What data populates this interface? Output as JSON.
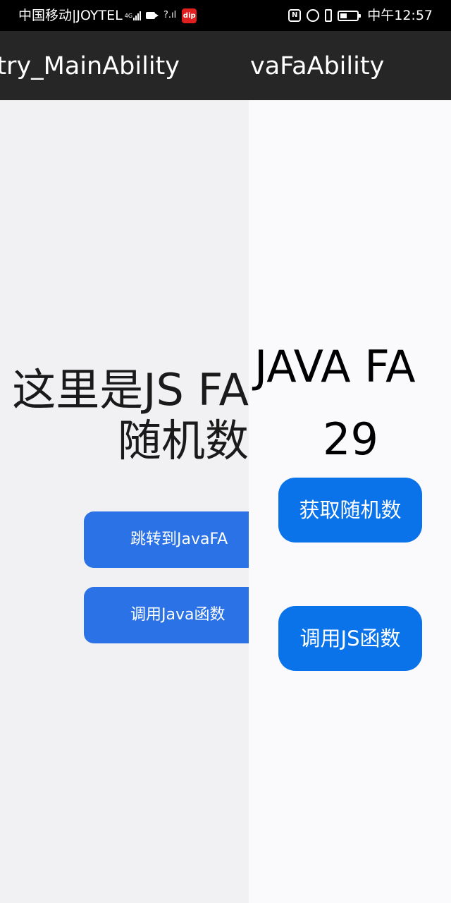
{
  "status_bar": {
    "carrier": "中国移动|JOYTEL",
    "network_label_1": "4G",
    "network_label_2": "?.ıl",
    "app_badge_text": "dip",
    "time": "中午12:57"
  },
  "title_bar": {
    "left_title": "ntry_MainAbility",
    "right_title": "vaFaAbility"
  },
  "left_page": {
    "heading_line1": "这里是JS FA",
    "heading_line2": "随机数",
    "buttons": [
      {
        "label": "跳转到JavaFA"
      },
      {
        "label": "调用Java函数"
      }
    ]
  },
  "right_page": {
    "heading_line1": "JAVA FA",
    "random_value": "29",
    "buttons": [
      {
        "label": "获取随机数"
      },
      {
        "label": "调用JS函数"
      }
    ]
  },
  "colors": {
    "status_bar": "#000000",
    "title_bar": "#262626",
    "left_button": "#2a72e6",
    "right_button": "#0a73ea"
  }
}
